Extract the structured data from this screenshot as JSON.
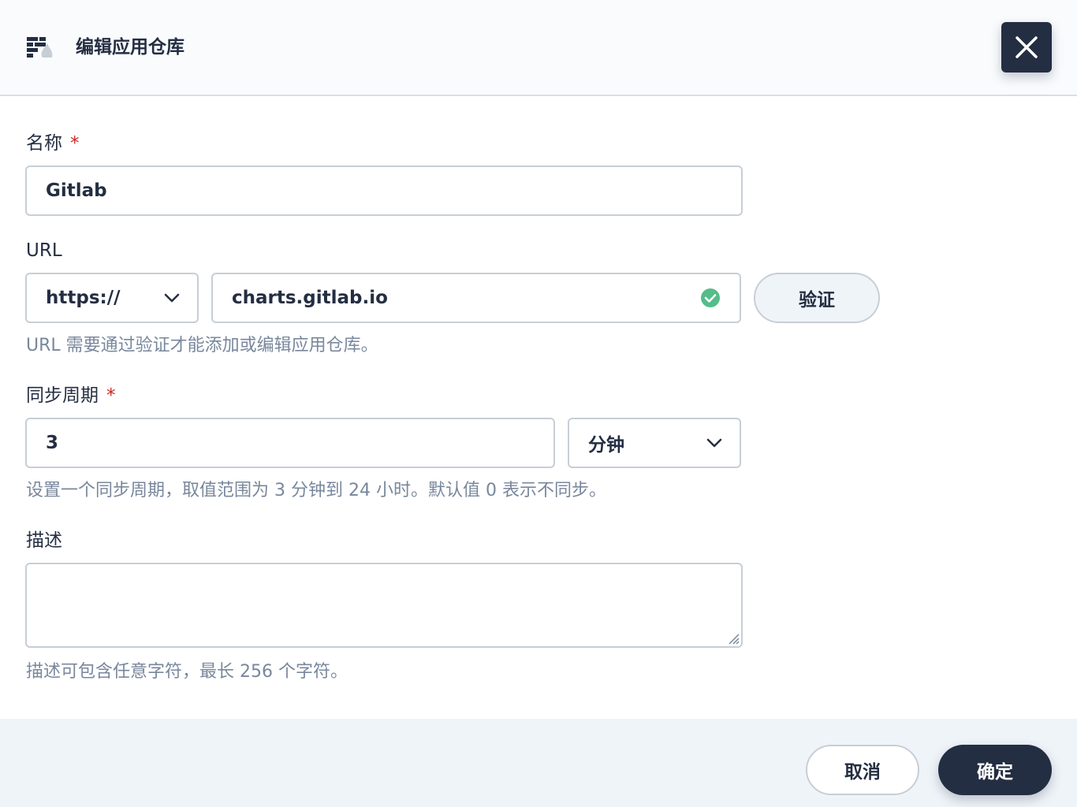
{
  "header": {
    "title": "编辑应用仓库",
    "icon": "app-repo-icon",
    "close_icon": "close-icon"
  },
  "form": {
    "name": {
      "label": "名称",
      "required_mark": "*",
      "value": "Gitlab"
    },
    "url": {
      "label": "URL",
      "protocol": "https://",
      "value": "charts.gitlab.io",
      "verified_icon": "check-circle-icon",
      "verify_label": "验证",
      "hint": "URL 需要通过验证才能添加或编辑应用仓库。"
    },
    "sync_period": {
      "label": "同步周期",
      "required_mark": "*",
      "value": "3",
      "unit": "分钟",
      "hint": "设置一个同步周期，取值范围为 3 分钟到 24 小时。默认值 0 表示不同步。"
    },
    "description": {
      "label": "描述",
      "value": "",
      "hint": "描述可包含任意字符，最长 256 个字符。"
    }
  },
  "footer": {
    "cancel_label": "取消",
    "ok_label": "确定"
  },
  "colors": {
    "primary": "#242e42",
    "required": "#ca2621",
    "success": "#55bc8a",
    "hint": "#79879c",
    "border": "#c7ced6"
  }
}
